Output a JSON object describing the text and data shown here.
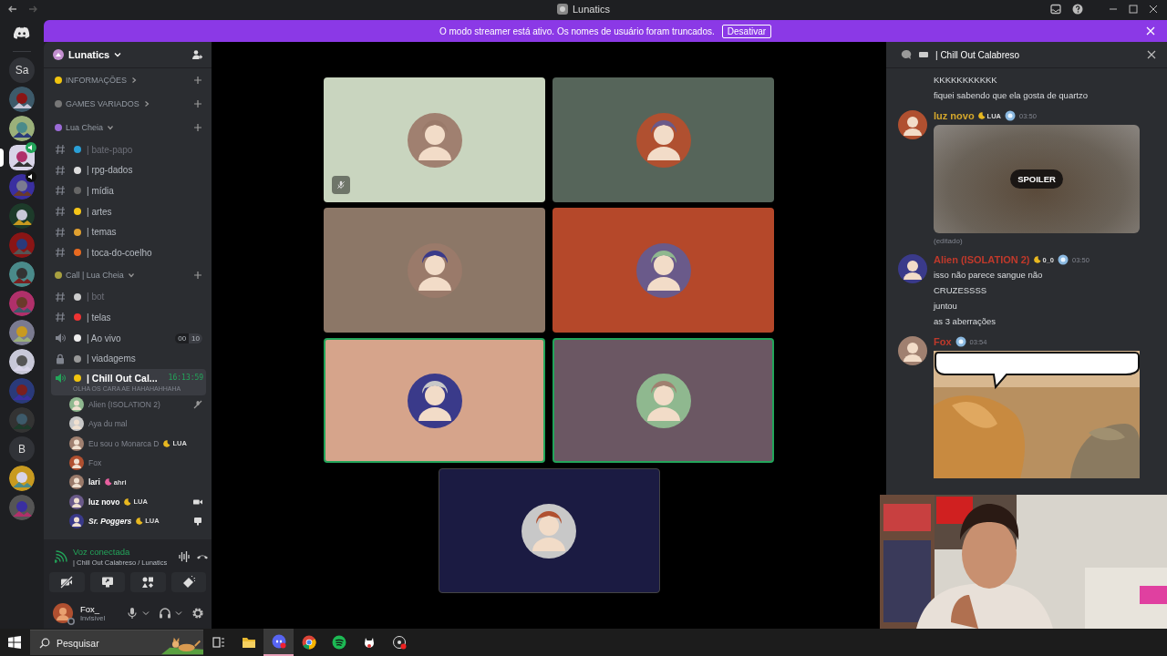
{
  "titlebar": {
    "title": "Lunatics"
  },
  "banner": {
    "text": "O modo streamer está ativo. Os nomes de usuário foram truncados.",
    "button": "Desativar"
  },
  "servers": [
    {
      "kind": "text",
      "label": "Sa",
      "selected": false,
      "voice": false
    },
    {
      "kind": "picture",
      "selected": false,
      "voice": false
    },
    {
      "kind": "picture",
      "selected": false,
      "voice": false
    },
    {
      "kind": "picture",
      "selected": true,
      "voice": true
    },
    {
      "kind": "picture",
      "selected": false,
      "voice": true
    },
    {
      "kind": "picture",
      "selected": false,
      "voice": false
    },
    {
      "kind": "picture",
      "selected": false,
      "voice": false
    },
    {
      "kind": "picture",
      "selected": false,
      "voice": false
    },
    {
      "kind": "picture",
      "selected": false,
      "voice": false
    },
    {
      "kind": "picture",
      "selected": false,
      "voice": false
    },
    {
      "kind": "picture",
      "selected": false,
      "voice": false
    },
    {
      "kind": "picture",
      "selected": false,
      "voice": false
    },
    {
      "kind": "picture",
      "selected": false,
      "voice": false
    },
    {
      "kind": "text",
      "label": "B",
      "selected": false,
      "voice": false
    },
    {
      "kind": "picture",
      "selected": false,
      "voice": false
    },
    {
      "kind": "picture",
      "selected": false,
      "voice": false
    }
  ],
  "sidebar": {
    "server_name": "Lunatics",
    "categories": [
      {
        "name": "INFORMAÇÕES",
        "expanded": false
      },
      {
        "name": "GAMES VARIADOS",
        "expanded": false
      },
      {
        "name": "Lua Cheia",
        "expanded": true,
        "channels": [
          {
            "kind": "text",
            "name": "| bate-papo",
            "dimmed": true,
            "selected": false
          },
          {
            "kind": "text",
            "name": "| rpg-dados",
            "dimmed": false,
            "selected": false
          },
          {
            "kind": "text",
            "name": "| mídia",
            "dimmed": false,
            "selected": false
          },
          {
            "kind": "text",
            "name": "| artes",
            "dimmed": false,
            "selected": false
          },
          {
            "kind": "text",
            "name": "| temas",
            "dimmed": false,
            "selected": false
          },
          {
            "kind": "text",
            "name": "| toca-do-coelho",
            "dimmed": false,
            "selected": false
          }
        ]
      },
      {
        "name": "Call | Lua Cheia",
        "expanded": true,
        "channels": [
          {
            "kind": "text",
            "name": "| bot",
            "dimmed": true,
            "selected": false
          },
          {
            "kind": "text",
            "name": "| telas",
            "dimmed": false,
            "selected": false
          },
          {
            "kind": "voice",
            "name": "| Ao vivo",
            "dimmed": false,
            "selected": false,
            "limit": [
              "00",
              "10"
            ]
          },
          {
            "kind": "locked",
            "name": "| viadagems",
            "dimmed": false,
            "selected": false
          },
          {
            "kind": "voice",
            "name": "| Chill Out Cal...",
            "dimmed": false,
            "selected": true,
            "timer": "16:13:59",
            "status": "OLHA OS CARA AE HAHAHAHHAHA",
            "members": [
              {
                "kind": "deafened",
                "name": "Alien (ISOLATION 2)",
                "bright": false
              },
              {
                "kind": "plain",
                "name": "Aya du mal",
                "bright": false
              },
              {
                "kind": "plain",
                "name": "Eu sou o Monarca D",
                "tag": "LUA",
                "bright": false
              },
              {
                "kind": "plain",
                "name": "Fox",
                "bright": false
              },
              {
                "kind": "plain",
                "name": "lari",
                "tag": "ahri",
                "bright": true
              },
              {
                "kind": "video",
                "name": "luz novo",
                "tag": "LUA",
                "bright": true
              },
              {
                "kind": "stream",
                "name": "Sr. Poggers",
                "tag": "LUA",
                "bright": true
              }
            ]
          }
        ]
      }
    ]
  },
  "voice_panel": {
    "status": "Voz conectada",
    "channel": "| Chill Out Calabreso / Lunatics"
  },
  "user": {
    "name": "Fox_",
    "status": "Invisível"
  },
  "stage": {
    "tiles": [
      {
        "color": "#c9d5bf",
        "speaking": false,
        "muted": true
      },
      {
        "color": "#56655a",
        "speaking": false,
        "muted": false
      },
      {
        "color": "#8c7767",
        "speaking": false,
        "muted": false
      },
      {
        "color": "#b5482a",
        "speaking": false,
        "muted": false
      },
      {
        "color": "#d6a48b",
        "speaking": true,
        "muted": false
      },
      {
        "color": "#6b5763",
        "speaking": true,
        "muted": false
      },
      {
        "color": "#1b1b42",
        "speaking": false,
        "muted": false
      }
    ]
  },
  "chat": {
    "title": "| Chill Out Calabreso",
    "messages": [
      {
        "kind": "text",
        "lines": [
          "KKKKKKKKKKK",
          "fiquei sabendo que ela gosta de quartzo"
        ]
      },
      {
        "kind": "spoiler",
        "author": "luz novo",
        "color": "#d4a72c",
        "tag": "LUA",
        "time": "03:50",
        "attachment_label": "SPOILER",
        "edited": "(editado)"
      },
      {
        "kind": "text",
        "author": "Alien (ISOLATION 2)",
        "color": "#c0392b",
        "tag": "0_0",
        "time": "03:50",
        "lines": [
          "isso não parece sangue não",
          "CRUZESSSS",
          "juntou",
          "as 3 aberrações"
        ]
      },
      {
        "kind": "picture",
        "author": "Fox",
        "color": "#c0392b",
        "time": "03:54"
      }
    ]
  },
  "taskbar": {
    "search": "Pesquisar",
    "apps": [
      {
        "kind": "taskview",
        "selected": false
      },
      {
        "kind": "folder",
        "selected": false
      },
      {
        "kind": "discord",
        "selected": true
      },
      {
        "kind": "chrome",
        "selected": false
      },
      {
        "kind": "spotify",
        "selected": false
      },
      {
        "kind": "mascot",
        "selected": false
      },
      {
        "kind": "recorder",
        "selected": false
      }
    ]
  }
}
